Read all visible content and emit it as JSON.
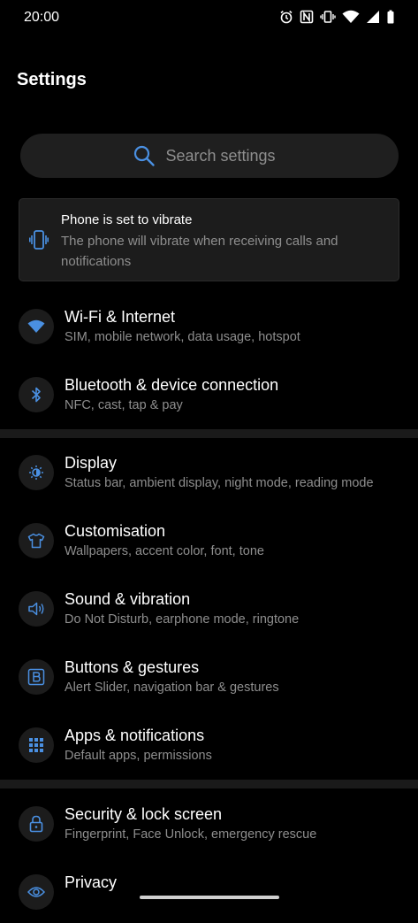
{
  "status": {
    "time": "20:00"
  },
  "header": {
    "title": "Settings"
  },
  "search": {
    "placeholder": "Search settings"
  },
  "notice": {
    "title": "Phone is set to vibrate",
    "text": "The phone will vibrate when receiving calls and notifications"
  },
  "settings": [
    {
      "title": "Wi-Fi & Internet",
      "subtitle": "SIM, mobile network, data usage, hotspot",
      "icon": "wifi-icon"
    },
    {
      "title": "Bluetooth & device connection",
      "subtitle": "NFC, cast, tap & pay",
      "icon": "bluetooth-icon"
    },
    {
      "title": "Display",
      "subtitle": "Status bar, ambient display, night mode, reading mode",
      "icon": "brightness-icon"
    },
    {
      "title": "Customisation",
      "subtitle": "Wallpapers, accent color, font, tone",
      "icon": "tshirt-icon"
    },
    {
      "title": "Sound & vibration",
      "subtitle": "Do Not Disturb, earphone mode, ringtone",
      "icon": "speaker-icon"
    },
    {
      "title": "Buttons & gestures",
      "subtitle": "Alert Slider, navigation bar & gestures",
      "icon": "button-b-icon"
    },
    {
      "title": "Apps & notifications",
      "subtitle": "Default apps, permissions",
      "icon": "apps-grid-icon"
    },
    {
      "title": "Security & lock screen",
      "subtitle": "Fingerprint, Face Unlock, emergency rescue",
      "icon": "lock-icon"
    },
    {
      "title": "Privacy",
      "subtitle": "",
      "icon": "privacy-icon"
    }
  ],
  "colors": {
    "accent": "#4a90e2",
    "background": "#000000",
    "surface": "#1c1c1c",
    "secondary_text": "#8e8e8e"
  }
}
